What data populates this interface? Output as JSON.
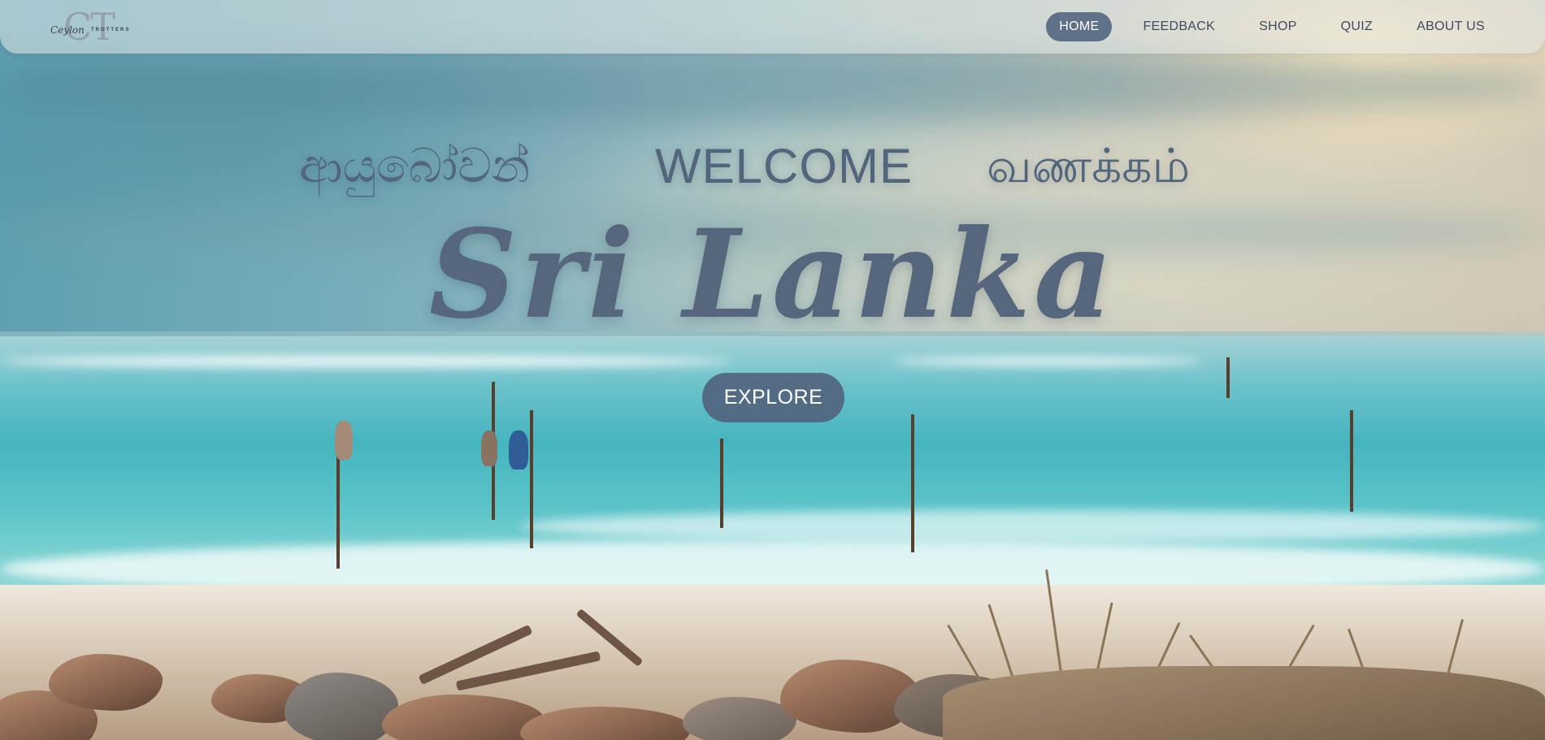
{
  "header": {
    "logo": {
      "monogram": "CT",
      "script": "Ceylon",
      "word": "TROTTERS"
    },
    "nav": [
      {
        "label": "HOME",
        "active": true
      },
      {
        "label": "FEEDBACK",
        "active": false
      },
      {
        "label": "SHOP",
        "active": false
      },
      {
        "label": "QUIZ",
        "active": false
      },
      {
        "label": "ABOUT US",
        "active": false
      }
    ]
  },
  "hero": {
    "greetings": {
      "sinhala": "ආයුබෝවන්",
      "english": "WELCOME",
      "tamil": "வணக்கம்"
    },
    "title": "Sri Lanka",
    "cta_label": "EXPLORE"
  },
  "colors": {
    "nav_active_bg": "#5e7188",
    "text_primary": "#51657d",
    "button_bg": "#51637b"
  },
  "background": {
    "description_icon": "stilt-fishermen-beach-image"
  }
}
